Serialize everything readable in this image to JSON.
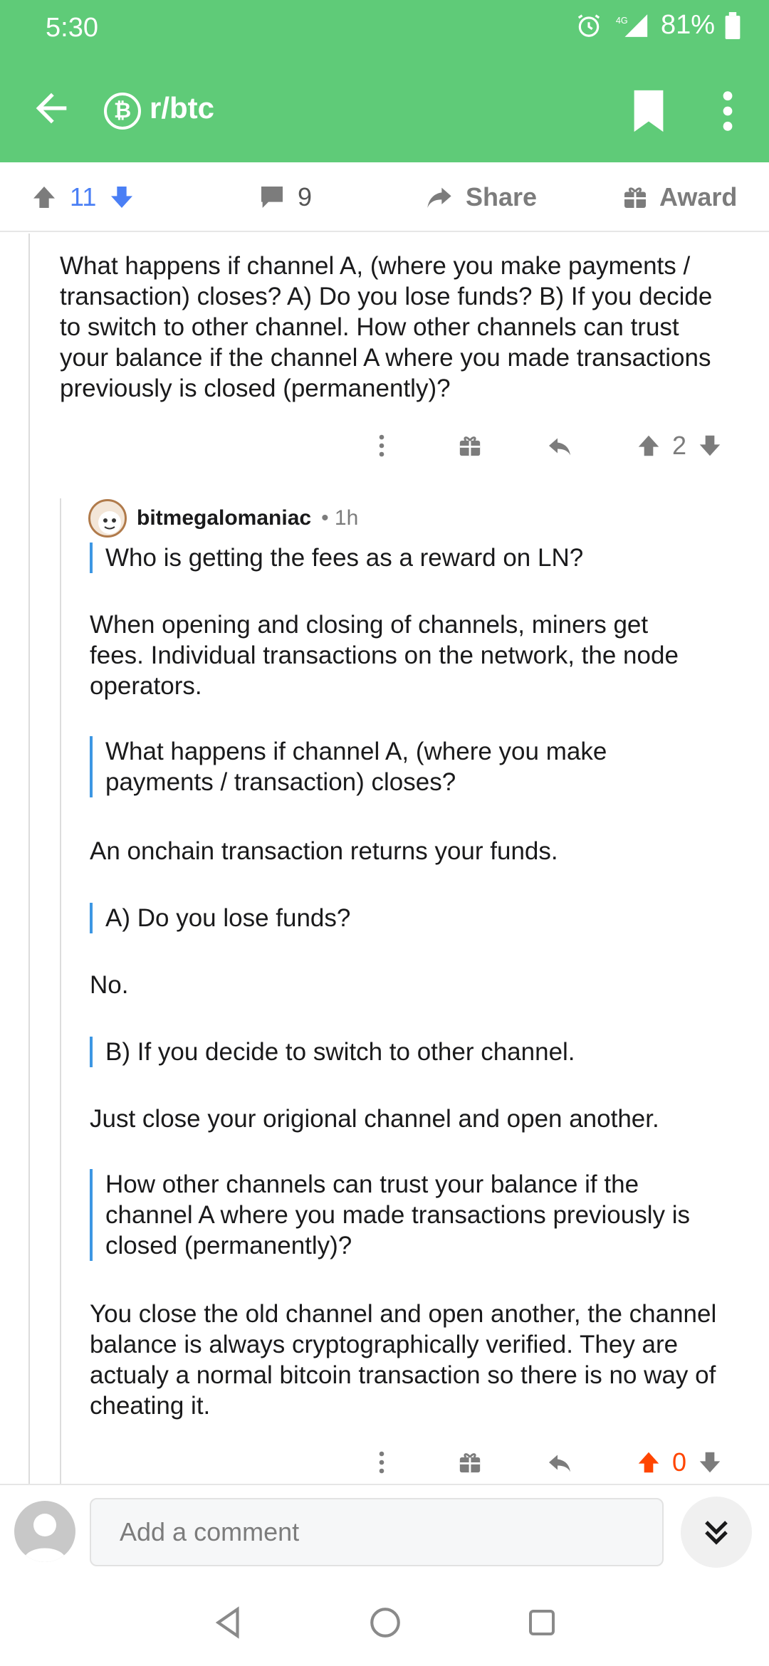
{
  "status": {
    "time": "5:30",
    "network": "4G",
    "battery": "81%"
  },
  "header": {
    "subreddit": "r/btc",
    "sub_icon_glyph": "₿",
    "accent": "#5fcb78"
  },
  "post_actions": {
    "upvotes": "11",
    "comments": "9",
    "share_label": "Share",
    "award_label": "Award",
    "upvote_color": "#4a7ff5"
  },
  "parent_comment": {
    "lines": [
      "What happens if channel A, (where you make payments /",
      "transaction) closes? A) Do you lose funds? B) If you decide",
      "to switch to other channel. How other channels can trust",
      "your balance if the channel A where you made transactions",
      "previously is closed (permanently)?"
    ],
    "score": "2"
  },
  "reply": {
    "author": "bitmegalomaniac",
    "time": "• 1h",
    "blocks": [
      {
        "type": "quote",
        "lines": [
          "Who is getting the fees as a reward on LN?"
        ]
      },
      {
        "type": "text",
        "lines": [
          "When opening and closing of channels, miners get",
          "fees.  Individual transactions on the network, the node",
          "operators."
        ]
      },
      {
        "type": "quote",
        "lines": [
          "What happens if channel A, (where you make",
          "payments / transaction) closes?"
        ]
      },
      {
        "type": "text",
        "lines": [
          "An onchain transaction returns your funds."
        ]
      },
      {
        "type": "quote",
        "lines": [
          "A) Do you lose funds?"
        ]
      },
      {
        "type": "text",
        "lines": [
          "No."
        ]
      },
      {
        "type": "quote",
        "lines": [
          "B) If you decide to switch to other channel."
        ]
      },
      {
        "type": "text",
        "lines": [
          "Just close your origional channel and open another."
        ]
      },
      {
        "type": "quote",
        "lines": [
          "How other channels can trust your balance if the",
          "channel A where you made transactions previously is",
          "closed (permanently)?"
        ]
      },
      {
        "type": "text",
        "lines": [
          "You close the old channel and open another, the channel",
          "balance is always cryptographically verified.  They are",
          "actualy a normal bitcoin transaction so there is no way of",
          "cheating it."
        ]
      }
    ],
    "score": "0",
    "score_color": "#ff4500"
  },
  "composer": {
    "placeholder": "Add a comment"
  }
}
